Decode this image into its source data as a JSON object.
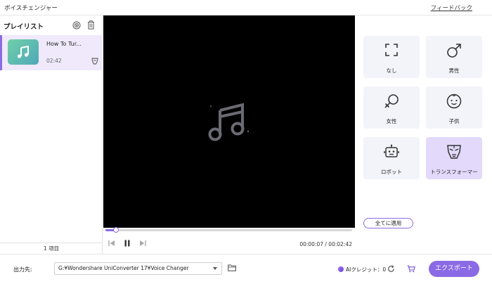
{
  "app": {
    "title": "ボイスチェンジャー",
    "feedback_label": "フィードバック"
  },
  "playlist": {
    "title": "プレイリスト",
    "items": [
      {
        "name": "How To Tur...",
        "duration": "02:42"
      }
    ],
    "count_label": "1 項目"
  },
  "player": {
    "current_time": "00:00:07",
    "total_time": "00:02:42",
    "time_display": "00:00:07 / 00:02:42",
    "progress": 0.044
  },
  "voices": [
    {
      "label": "なし",
      "icon": "fullscreen-icon"
    },
    {
      "label": "男性",
      "icon": "male-icon"
    },
    {
      "label": "女性",
      "icon": "female-icon"
    },
    {
      "label": "子供",
      "icon": "child-face-icon"
    },
    {
      "label": "ロボット",
      "icon": "robot-icon"
    },
    {
      "label": "トランスフォーマー",
      "icon": "transformer-mask-icon",
      "selected": true
    }
  ],
  "apply_all_label": "全てに適用",
  "footer": {
    "output_label": "出力先:",
    "output_path": "G:¥Wondershare UniConverter 17¥Voice Changer",
    "ai_credit_label": "AIクレジット：0",
    "export_label": "エクスポート"
  },
  "colors": {
    "accent": "#8b6ae6",
    "selected_bg": "#e2d9fb",
    "card_bg": "#f2f4f9"
  }
}
